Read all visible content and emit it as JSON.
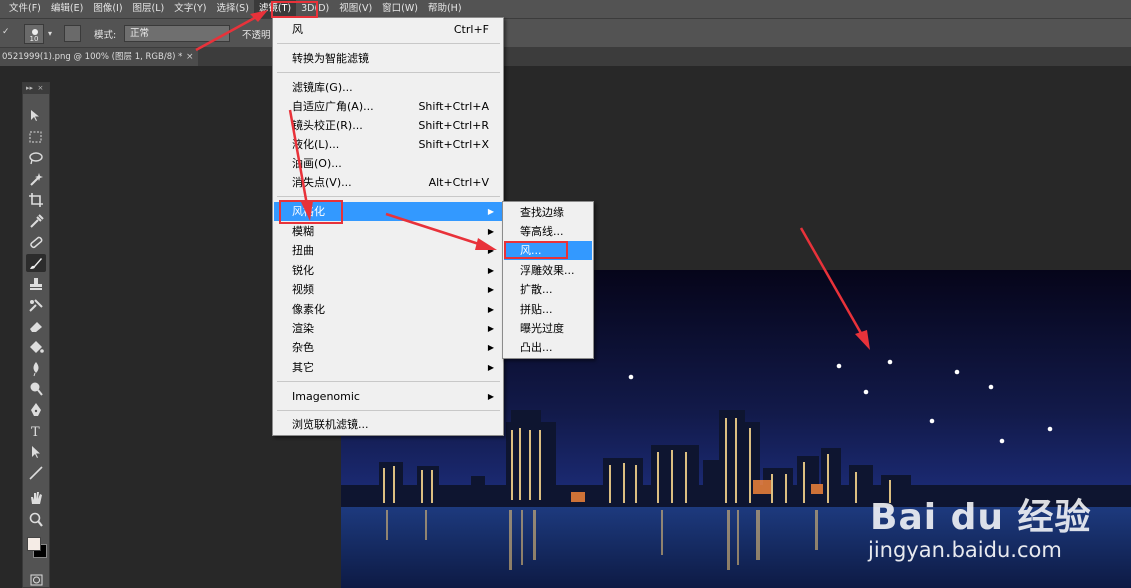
{
  "menubar": {
    "items": [
      "文件(F)",
      "编辑(E)",
      "图像(I)",
      "图层(L)",
      "文字(Y)",
      "选择(S)",
      "滤镜(T)",
      "3D(D)",
      "视图(V)",
      "窗口(W)",
      "帮助(H)"
    ]
  },
  "options": {
    "brush_size": "10",
    "mode_label": "模式:",
    "mode_value": "正常",
    "opacity_label": "不透明"
  },
  "document": {
    "tab_title": "0521999(1).png @ 100% (图层 1, RGB/8) *",
    "close": "×"
  },
  "filter_menu": {
    "last_filter": {
      "label": "风",
      "shortcut": "Ctrl+F"
    },
    "convert_smart": "转换为智能滤镜",
    "items": [
      {
        "label": "滤镜库(G)...",
        "shortcut": ""
      },
      {
        "label": "自适应广角(A)...",
        "shortcut": "Shift+Ctrl+A"
      },
      {
        "label": "镜头校正(R)...",
        "shortcut": "Shift+Ctrl+R"
      },
      {
        "label": "液化(L)...",
        "shortcut": "Shift+Ctrl+X"
      },
      {
        "label": "油画(O)...",
        "shortcut": ""
      },
      {
        "label": "消失点(V)...",
        "shortcut": "Alt+Ctrl+V"
      }
    ],
    "submenus": [
      "风格化",
      "模糊",
      "扭曲",
      "锐化",
      "视频",
      "像素化",
      "渲染",
      "杂色",
      "其它"
    ],
    "plugin": "Imagenomic",
    "browse": "浏览联机滤镜..."
  },
  "stylize_submenu": {
    "items": [
      "查找边缘",
      "等高线...",
      "风...",
      "浮雕效果...",
      "扩散...",
      "拼贴...",
      "曝光过度",
      "凸出..."
    ]
  },
  "watermark": {
    "logo": "Bai du 经验",
    "url": "jingyan.baidu.com"
  },
  "colors": {
    "highlight": "#3399ff",
    "annotation": "#e8323a",
    "menu_bg": "#f0f0f0",
    "app_bg": "#282828"
  }
}
